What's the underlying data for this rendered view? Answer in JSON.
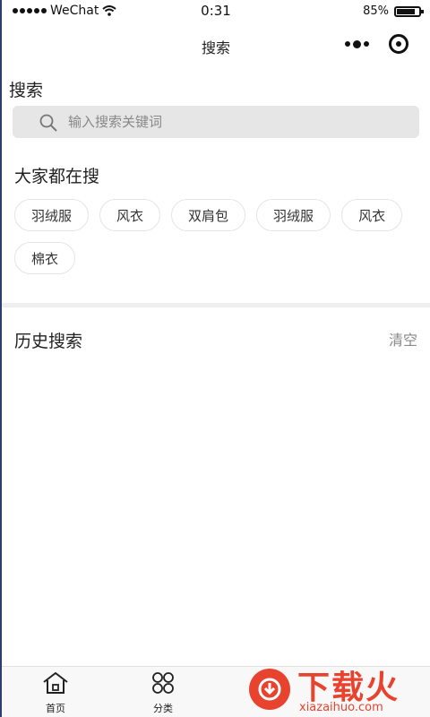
{
  "status_bar": {
    "carrier": "WeChat",
    "time": "0:31",
    "battery": "85%",
    "battery_level": 0.85
  },
  "nav": {
    "title": "搜索"
  },
  "search": {
    "heading": "搜索",
    "placeholder": "输入搜索关键词"
  },
  "popular": {
    "heading": "大家都在搜",
    "tags": [
      "羽绒服",
      "风衣",
      "双肩包",
      "羽绒服",
      "风衣",
      "棉衣"
    ]
  },
  "history": {
    "heading": "历史搜索",
    "clear_label": "清空"
  },
  "tabbar": {
    "items": [
      {
        "label": "首页",
        "icon": "home-icon"
      },
      {
        "label": "分类",
        "icon": "category-icon"
      }
    ]
  },
  "watermark": {
    "title": "下载火",
    "subtitle": "xiazaihuo.com"
  }
}
